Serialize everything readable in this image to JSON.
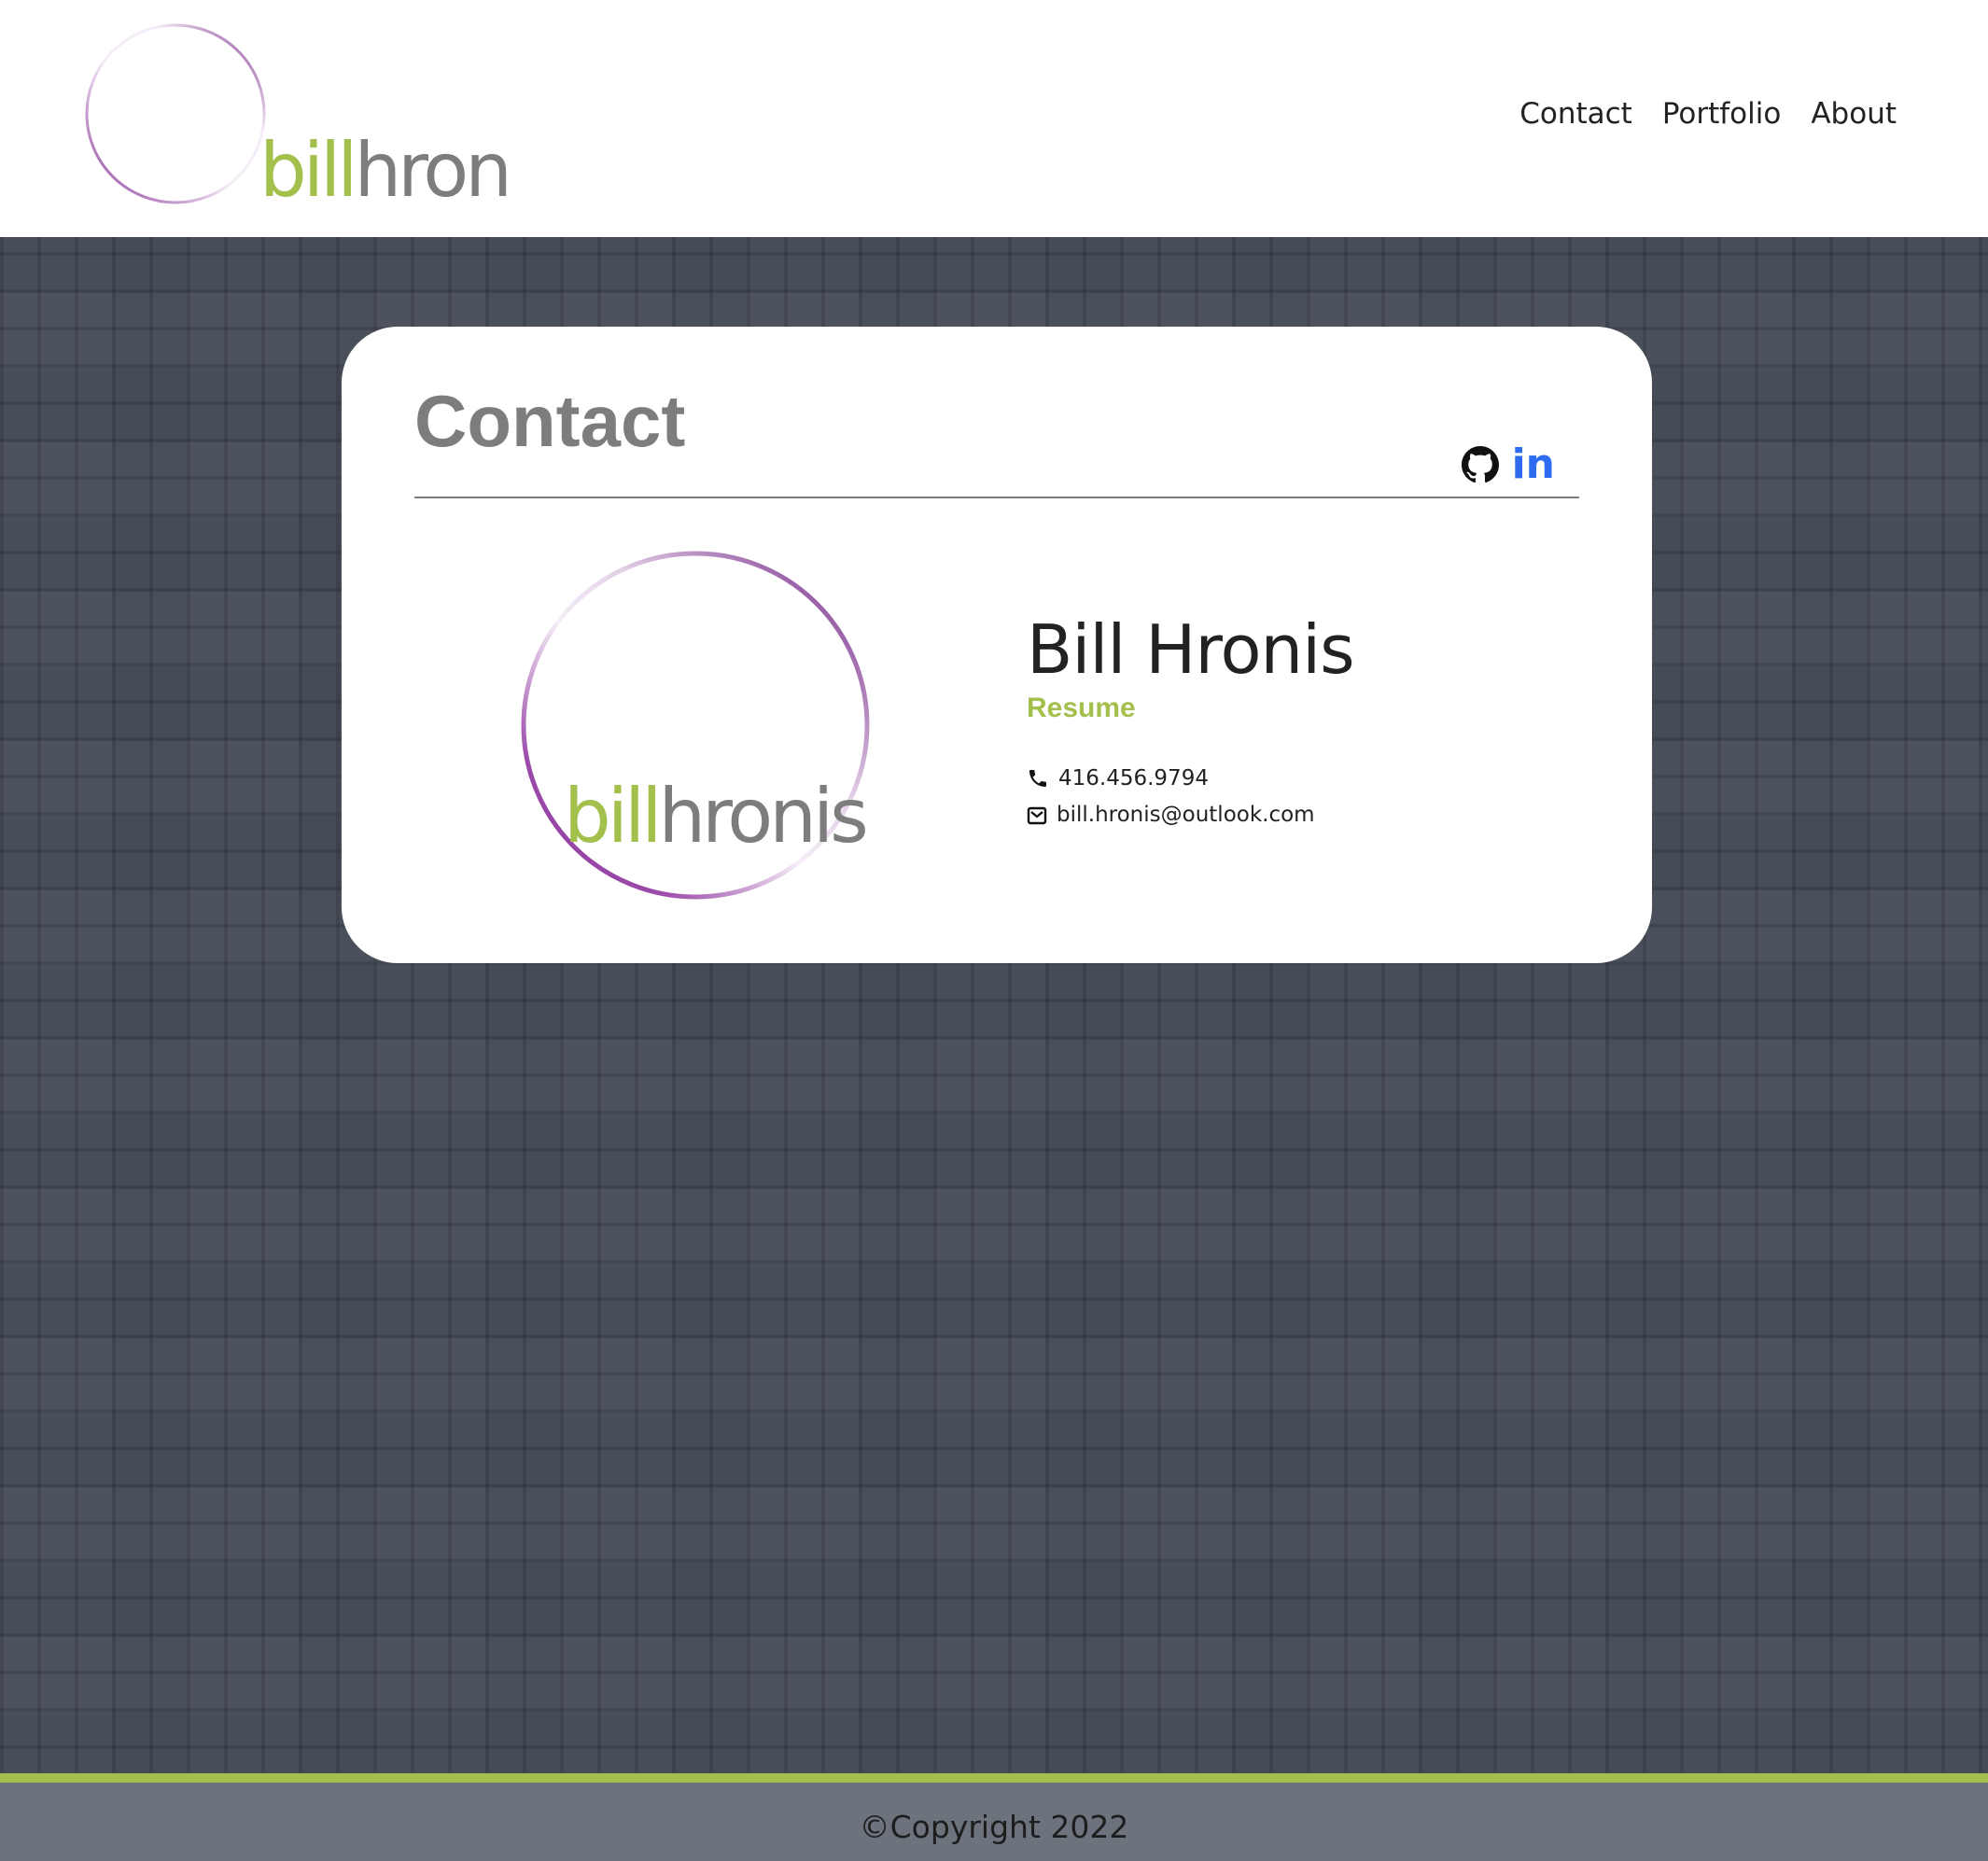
{
  "brand": {
    "logo_part1": "bill",
    "logo_part2": "hronis",
    "accent_green": "#a3c04c",
    "accent_purple": "#7b2a8d",
    "gray_text": "#7d7d7d"
  },
  "nav": {
    "items": [
      {
        "label": "Contact"
      },
      {
        "label": "Portfolio"
      },
      {
        "label": "About"
      }
    ]
  },
  "card": {
    "title": "Contact",
    "social": {
      "github_icon": "github-icon",
      "linkedin_label": "in"
    },
    "name": "Bill Hronis",
    "resume_label": "Resume",
    "phone": "416.456.9794",
    "phone_icon": "phone-icon",
    "email": "bill.hronis@outlook.com",
    "email_icon": "envelope-icon"
  },
  "footer": {
    "copyright": "©Copyright 2022"
  }
}
